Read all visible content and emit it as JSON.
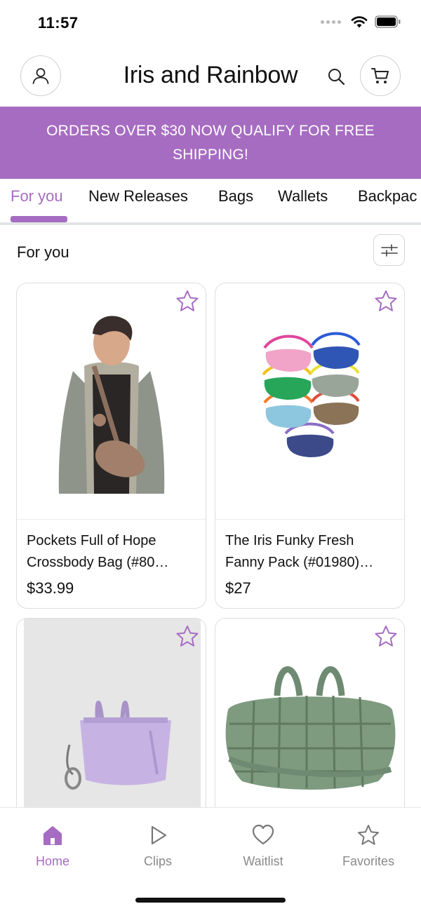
{
  "status_bar": {
    "time": "11:57"
  },
  "header": {
    "title": "Iris and Rainbow"
  },
  "banner": {
    "text": "ORDERS OVER $30 NOW QUALIFY FOR FREE SHIPPING!"
  },
  "tabs": [
    {
      "label": "For you",
      "active": true
    },
    {
      "label": "New Releases"
    },
    {
      "label": "Bags"
    },
    {
      "label": "Wallets"
    },
    {
      "label": "Backpac"
    }
  ],
  "section": {
    "title": "For you"
  },
  "products": [
    {
      "name": "Pockets Full of Hope Crossbody Bag (#80…",
      "price": "$33.99"
    },
    {
      "name": "The Iris Funky Fresh Fanny Pack (#01980)…",
      "price": "$27"
    },
    {
      "name": ""
    },
    {
      "name": ""
    }
  ],
  "bottom_nav": [
    {
      "label": "Home",
      "icon": "home-icon",
      "active": true
    },
    {
      "label": "Clips",
      "icon": "play-icon"
    },
    {
      "label": "Waitlist",
      "icon": "heart-icon"
    },
    {
      "label": "Favorites",
      "icon": "star-icon"
    }
  ],
  "colors": {
    "accent": "#a66cc1",
    "text": "#111111",
    "muted": "#8a8a8a",
    "border": "#dedede"
  }
}
